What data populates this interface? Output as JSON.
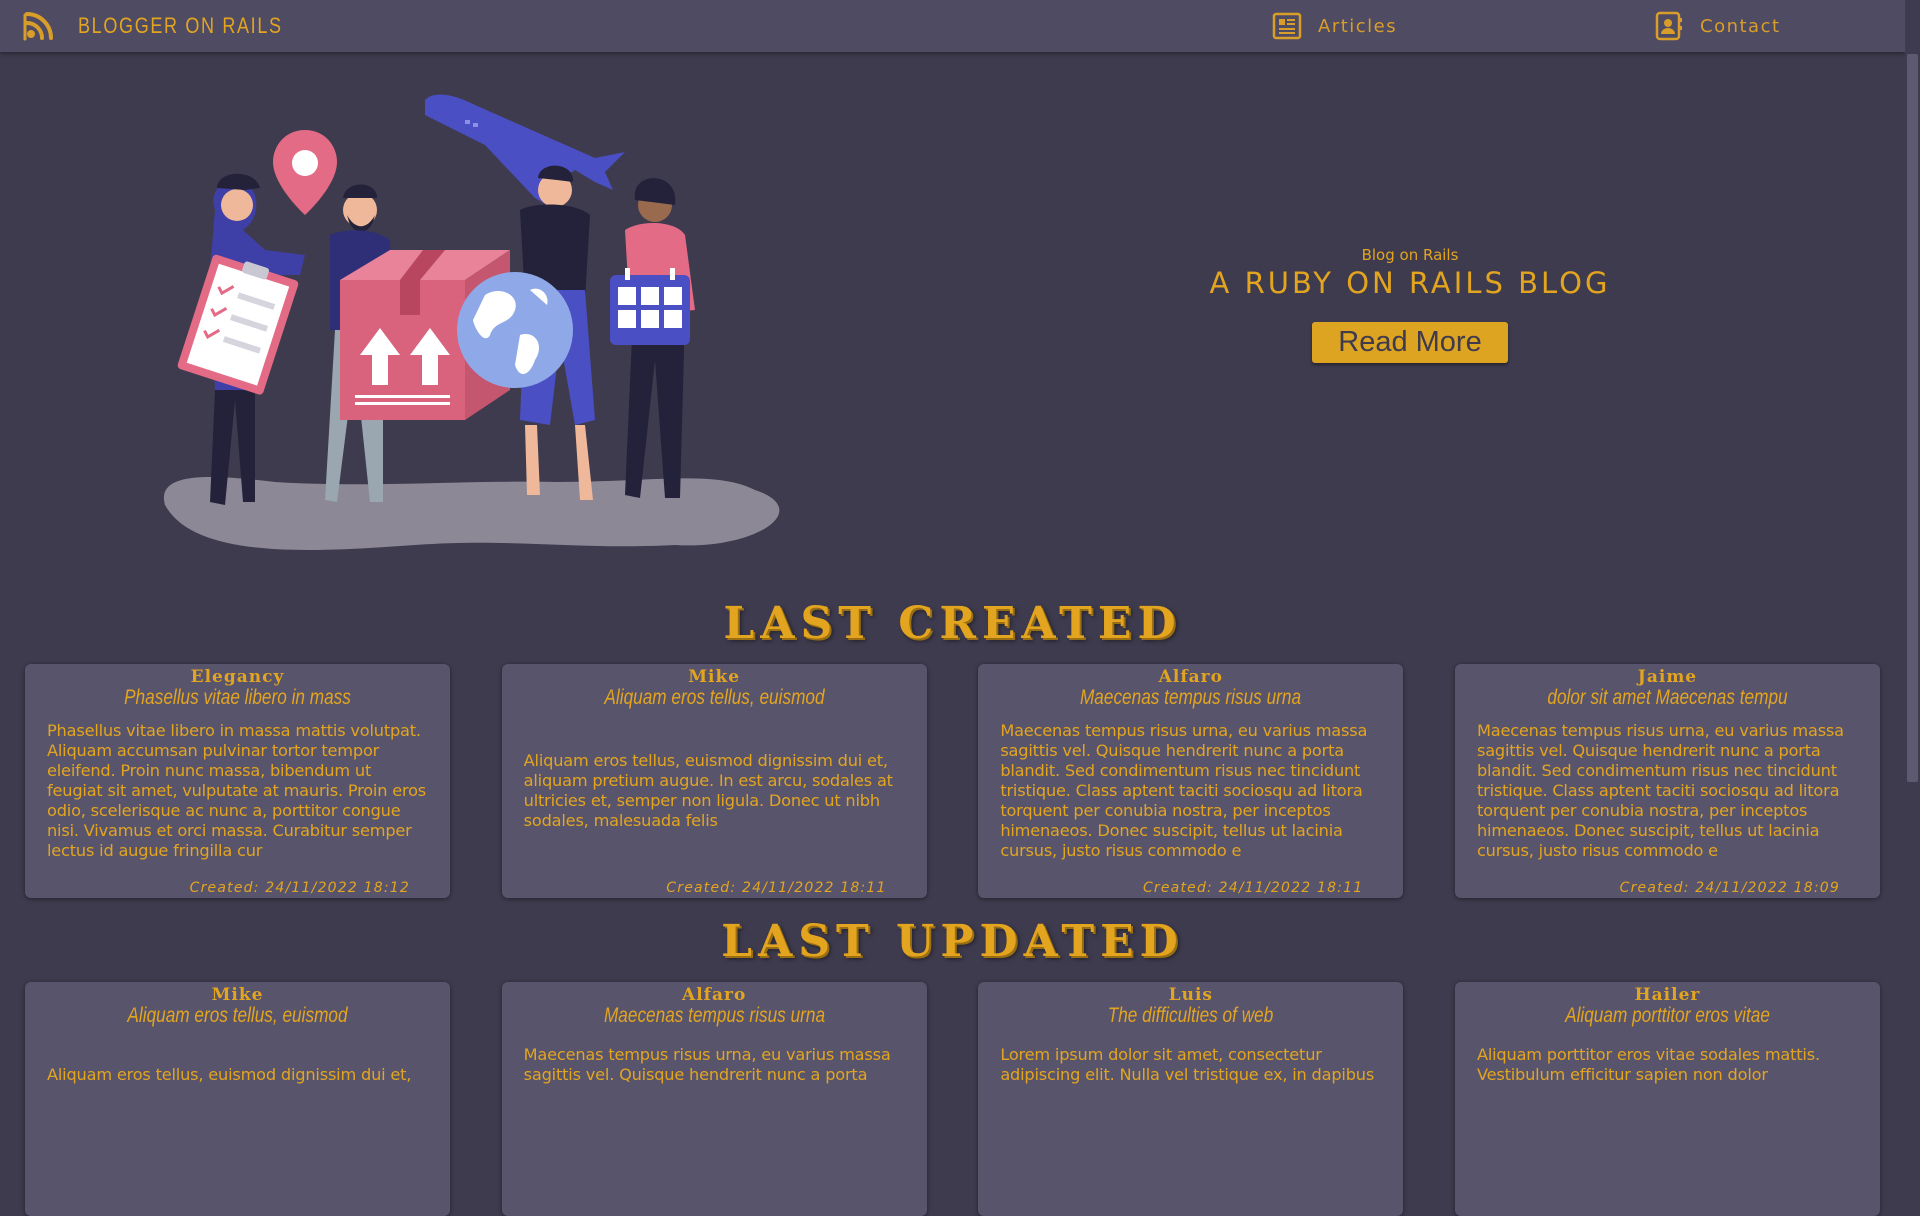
{
  "header": {
    "brand": "BLOGGER ON RAILS",
    "nav": [
      {
        "label": "Articles",
        "icon": "newspaper-icon"
      },
      {
        "label": "Contact",
        "icon": "contact-card-icon"
      }
    ]
  },
  "hero": {
    "kicker": "Blog on Rails",
    "title": "A RUBY ON RAILS BLOG",
    "button": "Read More"
  },
  "sections": {
    "created_title": "LAST CREATED",
    "updated_title": "LAST UPDATED"
  },
  "last_created": [
    {
      "author": "Elegancy",
      "title": "Phasellus vitae libero in mass",
      "body": "Phasellus vitae libero in massa mattis volutpat. Aliquam accumsan pulvinar tortor tempor eleifend. Proin nunc massa, bibendum ut feugiat sit amet, vulputate at mauris. Proin eros odio, scelerisque ac nunc a, porttitor congue nisi. Vivamus et orci massa. Curabitur semper lectus id augue fringilla cur",
      "created": "Created: 24/11/2022  18:12"
    },
    {
      "author": "Mike",
      "title": "Aliquam eros tellus, euismod",
      "body": "Aliquam eros tellus, euismod dignissim dui et, aliquam pretium augue. In est arcu, sodales at ultricies et, semper non ligula. Donec ut nibh sodales, malesuada felis",
      "created": "Created: 24/11/2022  18:11"
    },
    {
      "author": "Alfaro",
      "title": "Maecenas tempus risus urna",
      "body": "Maecenas tempus risus urna, eu varius massa sagittis vel. Quisque hendrerit nunc a porta blandit. Sed condimentum risus nec tincidunt tristique. Class aptent taciti sociosqu ad litora torquent per conubia nostra, per inceptos himenaeos. Donec suscipit, tellus ut lacinia cursus, justo risus commodo e",
      "created": "Created: 24/11/2022  18:11"
    },
    {
      "author": "Jaime",
      "title": "dolor sit amet Maecenas tempu",
      "body": "Maecenas tempus risus urna, eu varius massa sagittis vel. Quisque hendrerit nunc a porta blandit. Sed condimentum risus nec tincidunt tristique. Class aptent taciti sociosqu ad litora torquent per conubia nostra, per inceptos himenaeos. Donec suscipit, tellus ut lacinia cursus, justo risus commodo e",
      "created": "Created: 24/11/2022  18:09"
    }
  ],
  "last_updated": [
    {
      "author": "Mike",
      "title": "Aliquam eros tellus, euismod",
      "body": "Aliquam eros tellus, euismod dignissim dui et,"
    },
    {
      "author": "Alfaro",
      "title": "Maecenas tempus risus urna",
      "body": "Maecenas tempus risus urna, eu varius massa sagittis vel. Quisque hendrerit nunc a porta"
    },
    {
      "author": "Luis",
      "title": "The difficulties of web",
      "body": "Lorem ipsum dolor sit amet, consectetur adipiscing elit. Nulla vel tristique ex, in dapibus"
    },
    {
      "author": "Hailer",
      "title": "Aliquam porttitor eros vitae",
      "body": "Aliquam porttitor eros vitae sodales mattis. Vestibulum efficitur sapien non dolor"
    }
  ],
  "colors": {
    "background": "#3e3b4e",
    "header": "#4f4b62",
    "card": "#58546c",
    "accent": "#e3a51f"
  }
}
